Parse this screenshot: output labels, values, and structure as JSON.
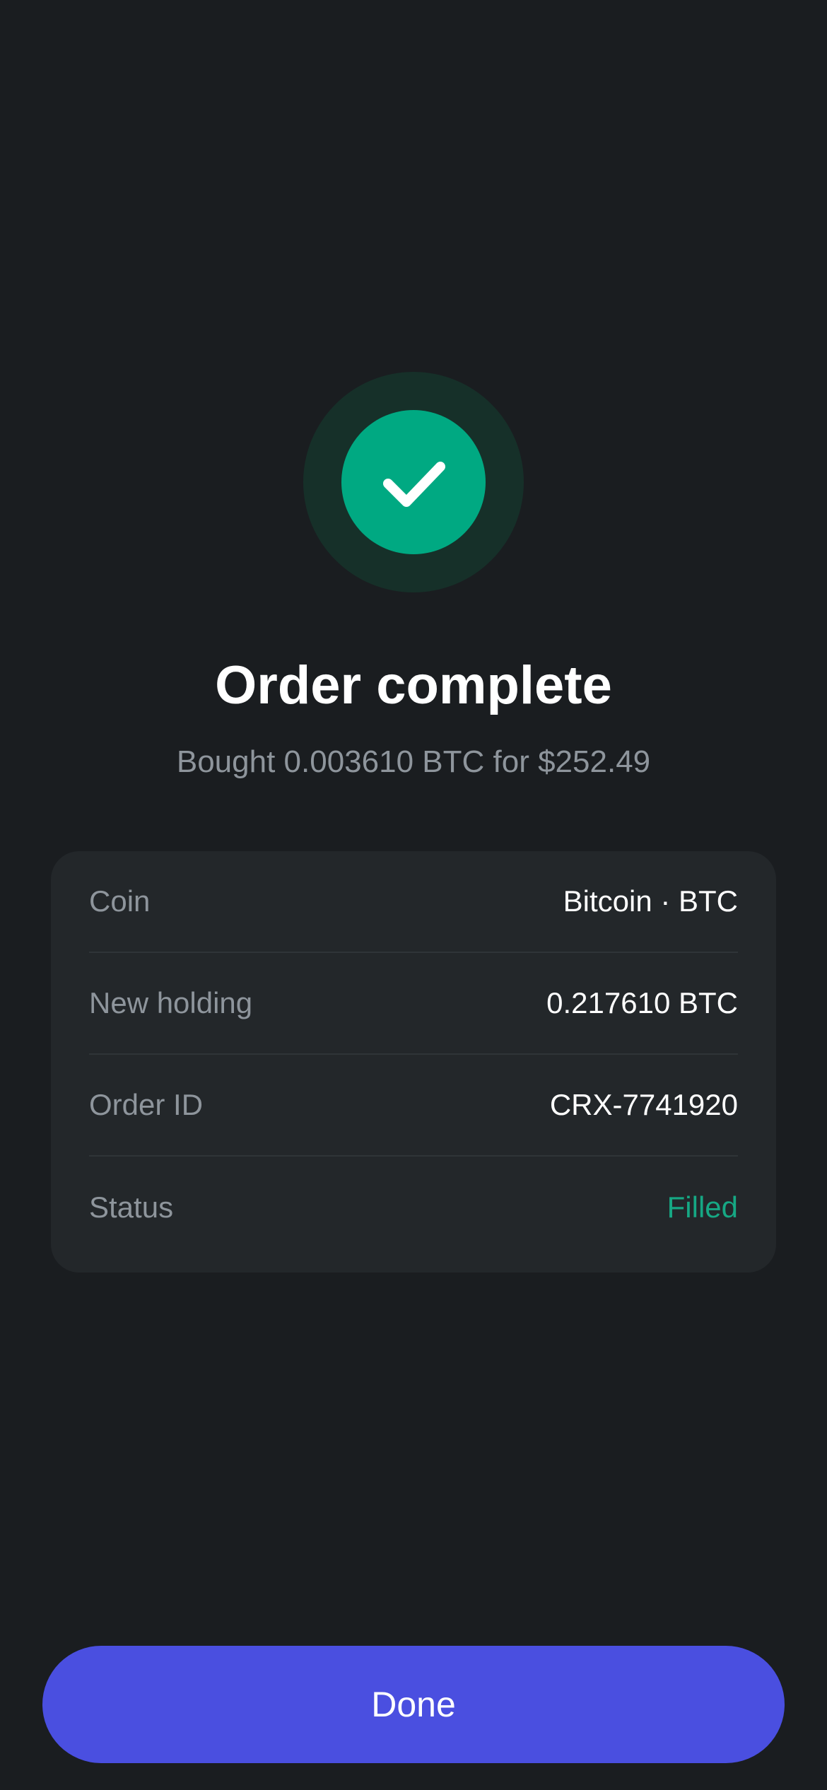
{
  "screen": {
    "title": "Order complete",
    "subtitle": "Bought 0.003610 BTC for $252.49",
    "icon": "checkmark-icon"
  },
  "details": {
    "rows": [
      {
        "label": "Coin",
        "value": "Bitcoin · BTC"
      },
      {
        "label": "New holding",
        "value": "0.217610 BTC"
      },
      {
        "label": "Order ID",
        "value": "CRX-7741920"
      },
      {
        "label": "Status",
        "value": "Filled"
      }
    ]
  },
  "actions": {
    "done_label": "Done"
  },
  "colors": {
    "background": "#1a1d20",
    "card": "#23272a",
    "success": "#00a982",
    "success_ring": "#163029",
    "status_filled": "#16a884",
    "primary_button": "#4a4fe0",
    "muted_text": "#8e959c"
  }
}
